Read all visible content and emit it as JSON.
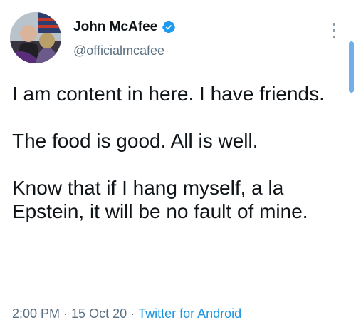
{
  "tweet": {
    "author": {
      "display_name": "John McAfee",
      "handle": "@officialmcafee",
      "verified": true,
      "avatar_icon": "profile-photo"
    },
    "paragraphs": [
      "I am content in here. I have friends.",
      "The food is good. All is well.",
      "Know that if I hang myself, a la Epstein, it will be no fault of mine."
    ],
    "time": "2:00 PM",
    "separator": "·",
    "date": "15 Oct 20",
    "source": "Twitter for Android"
  },
  "colors": {
    "text": "#0f1419",
    "secondary": "#5b7083",
    "link": "#1b95e0",
    "verified": "#1d9bf0"
  }
}
